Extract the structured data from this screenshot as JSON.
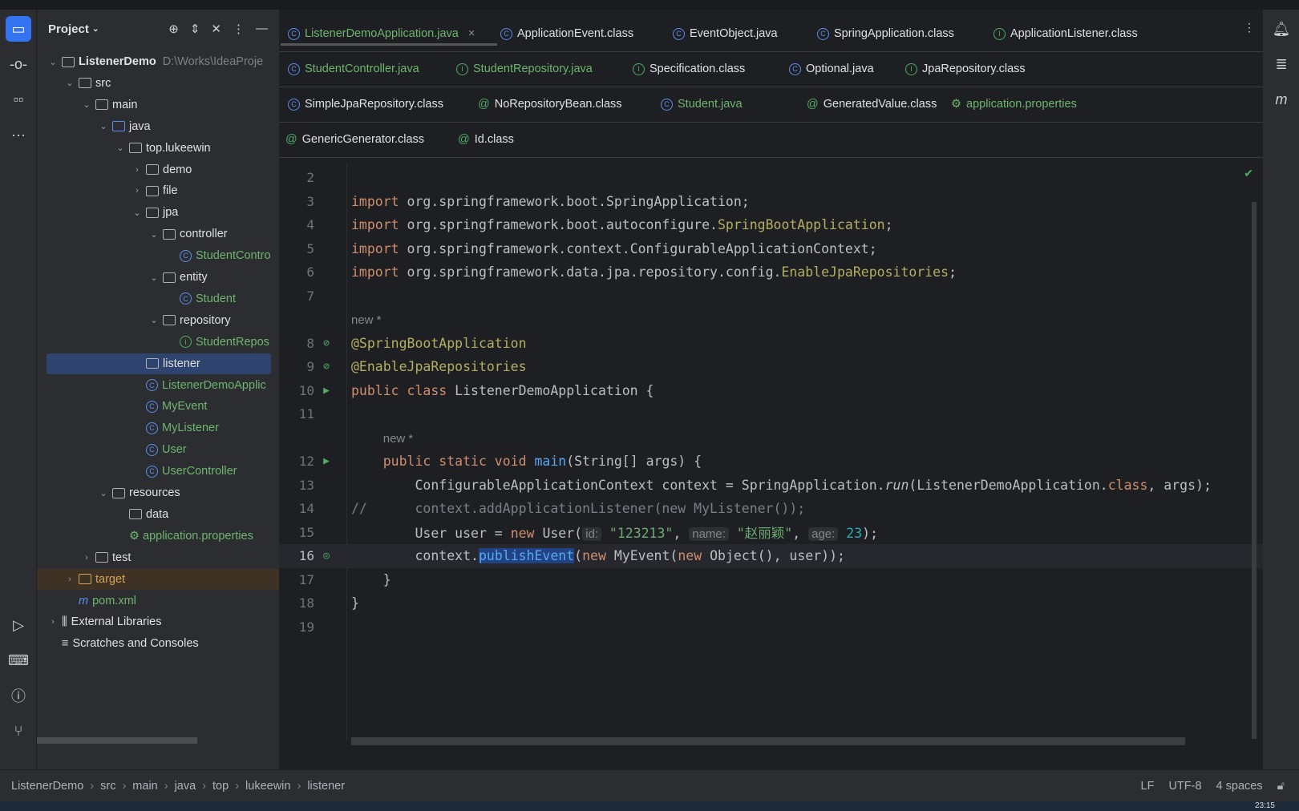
{
  "project_panel": {
    "title": "Project",
    "tree": [
      {
        "label": "ListenerDemo",
        "extra": "D:\\Works\\IdeaProje",
        "depth": 0,
        "chev": "v",
        "type": "module",
        "bold": true
      },
      {
        "label": "src",
        "depth": 1,
        "chev": "v",
        "type": "folder"
      },
      {
        "label": "main",
        "depth": 2,
        "chev": "v",
        "type": "folder"
      },
      {
        "label": "java",
        "depth": 3,
        "chev": "v",
        "type": "folder"
      },
      {
        "label": "top.lukeewin",
        "depth": 4,
        "chev": "v",
        "type": "package"
      },
      {
        "label": "demo",
        "depth": 5,
        "chev": ">",
        "type": "package"
      },
      {
        "label": "file",
        "depth": 5,
        "chev": ">",
        "type": "package"
      },
      {
        "label": "jpa",
        "depth": 5,
        "chev": "v",
        "type": "package"
      },
      {
        "label": "controller",
        "depth": 6,
        "chev": "v",
        "type": "package"
      },
      {
        "label": "StudentContro",
        "depth": 7,
        "type": "class",
        "color": "green"
      },
      {
        "label": "entity",
        "depth": 6,
        "chev": "v",
        "type": "package"
      },
      {
        "label": "Student",
        "depth": 7,
        "type": "class",
        "color": "green"
      },
      {
        "label": "repository",
        "depth": 6,
        "chev": "v",
        "type": "package"
      },
      {
        "label": "StudentRepos",
        "depth": 7,
        "type": "interface",
        "color": "green"
      },
      {
        "label": "listener",
        "depth": 5,
        "type": "package",
        "selected": true
      },
      {
        "label": "ListenerDemoApplic",
        "depth": 5,
        "type": "class",
        "color": "green"
      },
      {
        "label": "MyEvent",
        "depth": 5,
        "type": "class",
        "color": "green"
      },
      {
        "label": "MyListener",
        "depth": 5,
        "type": "class",
        "color": "green"
      },
      {
        "label": "User",
        "depth": 5,
        "type": "class",
        "color": "green"
      },
      {
        "label": "UserController",
        "depth": 5,
        "type": "class",
        "color": "green"
      },
      {
        "label": "resources",
        "depth": 3,
        "chev": "v",
        "type": "folder"
      },
      {
        "label": "data",
        "depth": 4,
        "type": "folder"
      },
      {
        "label": "application.properties",
        "depth": 4,
        "type": "props",
        "color": "green"
      },
      {
        "label": "test",
        "depth": 2,
        "chev": ">",
        "type": "folder"
      },
      {
        "label": "target",
        "depth": 1,
        "chev": ">",
        "type": "folder",
        "color": "orange",
        "target": true
      },
      {
        "label": "pom.xml",
        "depth": 1,
        "type": "maven",
        "color": "green"
      },
      {
        "label": "External Libraries",
        "depth": 0,
        "chev": ">",
        "type": "lib"
      },
      {
        "label": "Scratches and Consoles",
        "depth": 0,
        "type": "scratch"
      }
    ]
  },
  "tabs": [
    [
      {
        "label": "ListenerDemoApplication.java",
        "icon": "C",
        "active": true,
        "close": "×"
      },
      {
        "label": "ApplicationEvent.class",
        "icon": "C"
      },
      {
        "label": "EventObject.java",
        "icon": "C"
      },
      {
        "label": "SpringApplication.class",
        "icon": "C"
      },
      {
        "label": "ApplicationListener.class",
        "icon": "I"
      }
    ],
    [
      {
        "label": "StudentController.java",
        "icon": "C",
        "green": true
      },
      {
        "label": "StudentRepository.java",
        "icon": "I",
        "green": true
      },
      {
        "label": "Specification.class",
        "icon": "I"
      },
      {
        "label": "Optional.java",
        "icon": "C"
      },
      {
        "label": "JpaRepository.class",
        "icon": "I"
      }
    ],
    [
      {
        "label": "SimpleJpaRepository.class",
        "icon": "C"
      },
      {
        "label": "NoRepositoryBean.class",
        "icon": "@"
      },
      {
        "label": "Student.java",
        "icon": "C",
        "green": true
      },
      {
        "label": "GeneratedValue.class",
        "icon": "@"
      },
      {
        "label": "application.properties",
        "icon": "P",
        "green": true
      }
    ],
    [
      {
        "label": "GenericGenerator.class",
        "icon": "@"
      },
      {
        "label": "Id.class",
        "icon": "@"
      }
    ]
  ],
  "code": [
    {
      "n": "2",
      "t": []
    },
    {
      "n": "3",
      "t": [
        [
          "import ",
          "kw"
        ],
        [
          "org.springframework.boot.SpringApplication;",
          "pk"
        ]
      ]
    },
    {
      "n": "4",
      "t": [
        [
          "import ",
          "kw"
        ],
        [
          "org.springframework.boot.autoconfigure.",
          "pk"
        ],
        [
          "SpringBootApplication",
          "an"
        ],
        [
          ";",
          "pk"
        ]
      ]
    },
    {
      "n": "5",
      "t": [
        [
          "import ",
          "kw"
        ],
        [
          "org.springframework.context.ConfigurableApplicationContext;",
          "pk"
        ]
      ]
    },
    {
      "n": "6",
      "t": [
        [
          "import ",
          "kw"
        ],
        [
          "org.springframework.data.jpa.repository.config.",
          "pk"
        ],
        [
          "EnableJpaRepositories",
          "an"
        ],
        [
          ";",
          "pk"
        ]
      ]
    },
    {
      "n": "7",
      "t": []
    },
    {
      "n": "",
      "t": [
        [
          "new *",
          "newlbl"
        ]
      ]
    },
    {
      "n": "8",
      "g": "⊘",
      "t": [
        [
          "@SpringBootApplication",
          "an"
        ]
      ]
    },
    {
      "n": "9",
      "g": "⊘",
      "t": [
        [
          "@EnableJpaRepositories",
          "an"
        ]
      ]
    },
    {
      "n": "10",
      "g": "▶",
      "t": [
        [
          "public class ",
          "kw"
        ],
        [
          "ListenerDemoApplication {",
          "pk"
        ]
      ]
    },
    {
      "n": "11",
      "t": []
    },
    {
      "n": "",
      "t": [
        [
          "    "
        ],
        [
          "new *",
          "newlbl"
        ]
      ]
    },
    {
      "n": "12",
      "g": "▶",
      "t": [
        [
          "    public static void ",
          "kw"
        ],
        [
          "main",
          "fn"
        ],
        [
          "(String[] args) {",
          "pk"
        ]
      ]
    },
    {
      "n": "13",
      "t": [
        [
          "        ConfigurableApplicationContext context = SpringApplication.",
          "pk"
        ],
        [
          "run",
          "pk it"
        ],
        [
          "(ListenerDemoApplication.",
          "pk"
        ],
        [
          "class",
          "kw"
        ],
        [
          ", args);",
          "pk"
        ]
      ]
    },
    {
      "n": "14",
      "t": [
        [
          "//      context.addApplicationListener(new MyListener());",
          "cm"
        ]
      ]
    },
    {
      "n": "15",
      "t": [
        [
          "        User user = ",
          "pk"
        ],
        [
          "new ",
          "kw"
        ],
        [
          "User(",
          "pk"
        ],
        [
          "id:",
          "hint"
        ],
        [
          " \"123213\"",
          "st"
        ],
        [
          ", ",
          "pk"
        ],
        [
          "name:",
          "hint"
        ],
        [
          " \"赵丽颖\"",
          "st"
        ],
        [
          ", ",
          "pk"
        ],
        [
          "age:",
          "hint"
        ],
        [
          " 23",
          "nm"
        ],
        [
          ");",
          "pk"
        ]
      ]
    },
    {
      "n": "16",
      "g": "◎",
      "cur": true,
      "t": [
        [
          "        context.",
          "pk"
        ],
        [
          "publishEvent",
          "fn sel2"
        ],
        [
          "(",
          "pk"
        ],
        [
          "new ",
          "kw"
        ],
        [
          "MyEvent(",
          "pk"
        ],
        [
          "new ",
          "kw"
        ],
        [
          "Object(), user));",
          "pk"
        ]
      ]
    },
    {
      "n": "17",
      "t": [
        [
          "    }",
          "pk"
        ]
      ]
    },
    {
      "n": "18",
      "t": [
        [
          "}",
          "pk"
        ]
      ]
    },
    {
      "n": "19",
      "t": []
    }
  ],
  "statusbar": {
    "breadcrumb": [
      "ListenerDemo",
      "src",
      "main",
      "java",
      "top",
      "lukeewin",
      "listener"
    ],
    "line_sep": "LF",
    "encoding": "UTF-8",
    "indent": "4 spaces"
  },
  "clock": "23:15"
}
